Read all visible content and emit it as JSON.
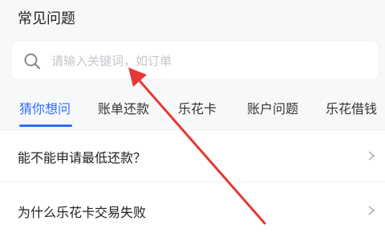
{
  "page": {
    "title": "常见问题"
  },
  "search": {
    "placeholder": "请输入关键词，如订单",
    "value": ""
  },
  "tabs": [
    {
      "label": "猜你想问",
      "active": true
    },
    {
      "label": "账单还款",
      "active": false
    },
    {
      "label": "乐花卡",
      "active": false
    },
    {
      "label": "账户问题",
      "active": false
    },
    {
      "label": "乐花借钱",
      "active": false
    }
  ],
  "faq": [
    {
      "question": "能不能申请最低还款？"
    },
    {
      "question": "为什么乐花卡交易失败"
    }
  ],
  "colors": {
    "accent": "#2f6bff",
    "arrow": "#e53935",
    "background": "#f7f8fa"
  },
  "icons": {
    "search": "search-icon",
    "chevron": "chevron-right-icon"
  }
}
